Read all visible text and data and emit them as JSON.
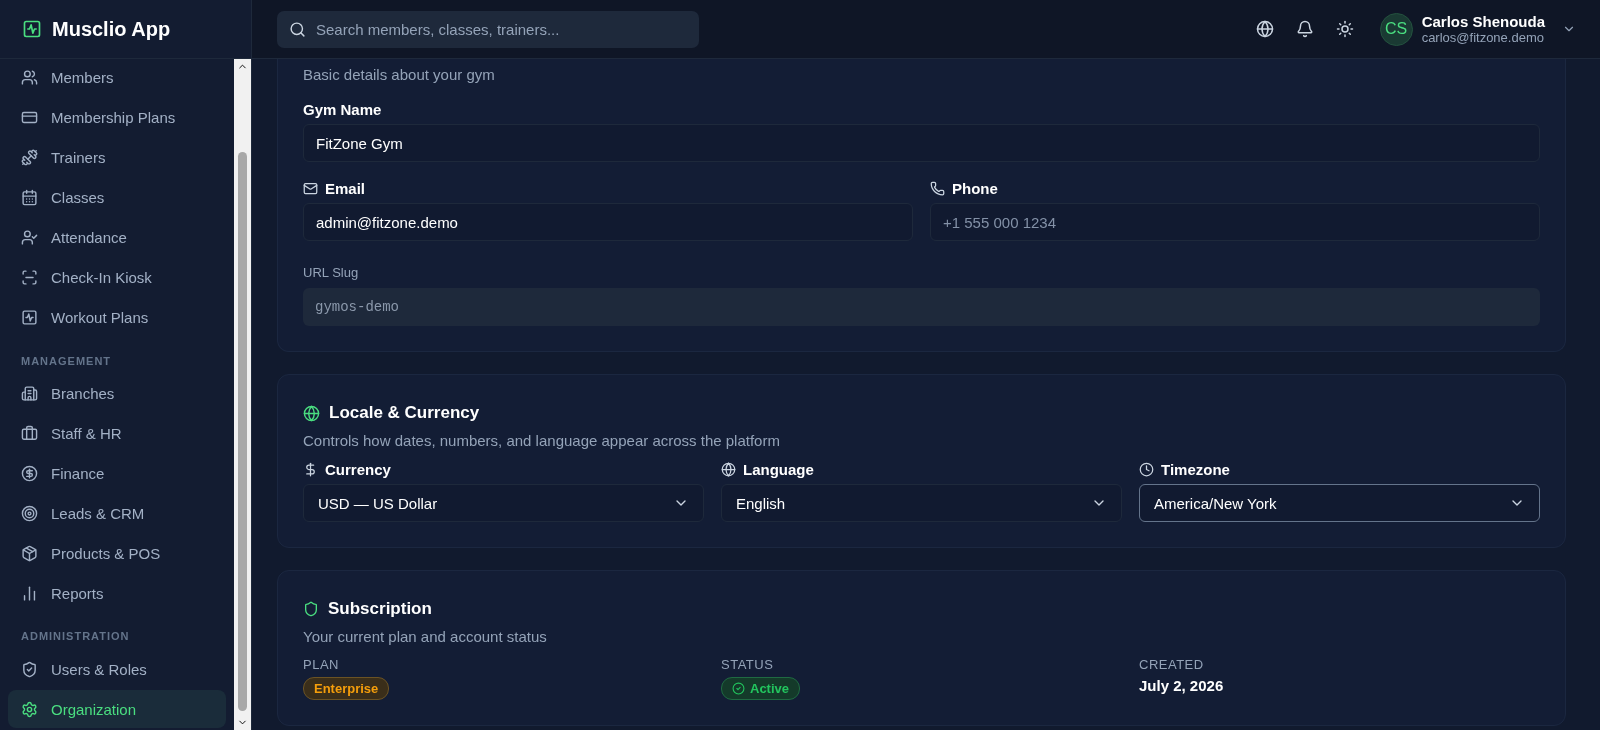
{
  "app": {
    "name": "Musclio App"
  },
  "sidebar": {
    "sections": [
      {
        "items": [
          {
            "label": "Members",
            "selected": false
          },
          {
            "label": "Membership Plans",
            "selected": false
          },
          {
            "label": "Trainers",
            "selected": false
          },
          {
            "label": "Classes",
            "selected": false
          },
          {
            "label": "Attendance",
            "selected": false
          },
          {
            "label": "Check-In Kiosk",
            "selected": false
          },
          {
            "label": "Workout Plans",
            "selected": false
          }
        ]
      },
      {
        "title": "MANAGEMENT",
        "items": [
          {
            "label": "Branches",
            "selected": false
          },
          {
            "label": "Staff & HR",
            "selected": false
          },
          {
            "label": "Finance",
            "selected": false
          },
          {
            "label": "Leads & CRM",
            "selected": false
          },
          {
            "label": "Products & POS",
            "selected": false
          },
          {
            "label": "Reports",
            "selected": false
          }
        ]
      },
      {
        "title": "ADMINISTRATION",
        "items": [
          {
            "label": "Users & Roles",
            "selected": false
          },
          {
            "label": "Organization",
            "selected": true
          }
        ]
      }
    ]
  },
  "header": {
    "search": {
      "placeholder": "Search members, classes, trainers..."
    },
    "user": {
      "initials": "CS",
      "name": "Carlos Shenouda",
      "email": "carlos@fitzone.demo"
    }
  },
  "general_card": {
    "subtitle": "Basic details about your gym",
    "gym_name": {
      "label": "Gym Name",
      "value": "FitZone Gym"
    },
    "email": {
      "label": "Email",
      "value": "admin@fitzone.demo"
    },
    "phone": {
      "label": "Phone",
      "placeholder": "+1 555 000 1234"
    },
    "url_slug": {
      "label": "URL Slug",
      "value": "gymos-demo"
    }
  },
  "locale_card": {
    "title": "Locale & Currency",
    "subtitle": "Controls how dates, numbers, and language appear across the platform",
    "selects": [
      {
        "label": "Currency",
        "value": "USD — US Dollar",
        "focused": false
      },
      {
        "label": "Language",
        "value": "English",
        "focused": false
      },
      {
        "label": "Timezone",
        "value": "America/New York",
        "focused": true
      }
    ]
  },
  "subscription_card": {
    "title": "Subscription",
    "subtitle": "Your current plan and account status",
    "fields": [
      {
        "label": "PLAN",
        "kind": "plan-badge",
        "value": "Enterprise"
      },
      {
        "label": "STATUS",
        "kind": "status-badge",
        "value": "Active"
      },
      {
        "label": "CREATED",
        "kind": "text",
        "value": "July 2, 2026"
      }
    ]
  }
}
